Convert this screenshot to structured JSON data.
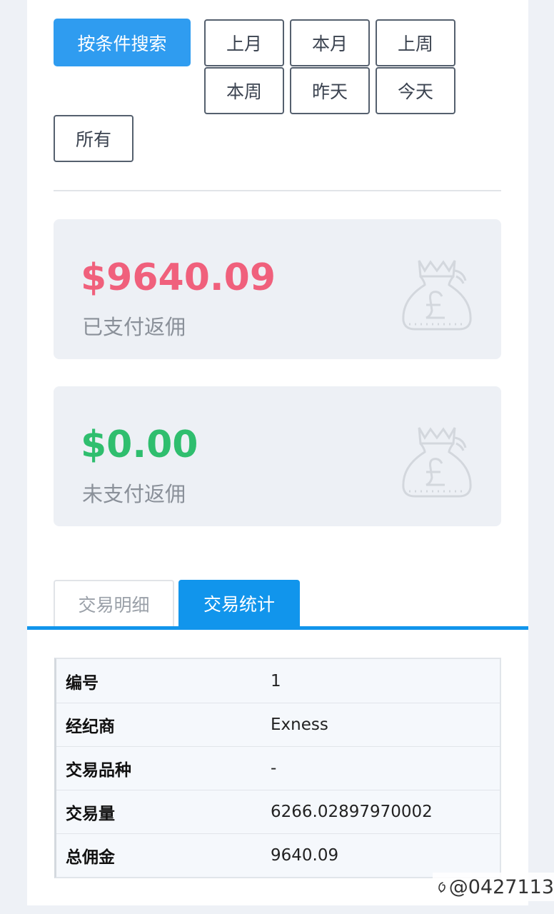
{
  "filters": {
    "search_label": "按条件搜索",
    "last_month": "上月",
    "this_month": "本月",
    "last_week": "上周",
    "this_week": "本周",
    "yesterday": "昨天",
    "today": "今天",
    "all": "所有"
  },
  "cards": {
    "paid": {
      "amount": "$9640.09",
      "label": "已支付返佣",
      "color": "#f0607c"
    },
    "unpaid": {
      "amount": "$0.00",
      "label": "未支付返佣",
      "color": "#2fbe6e"
    }
  },
  "tabs": {
    "details": "交易明细",
    "stats": "交易统计"
  },
  "stats_table": [
    {
      "key": "编号",
      "value": "1"
    },
    {
      "key": "经纪商",
      "value": "Exness"
    },
    {
      "key": "交易品种",
      "value": "-"
    },
    {
      "key": "交易量",
      "value": "6266.02897970002"
    },
    {
      "key": "总佣金",
      "value": "9640.09"
    }
  ],
  "watermark": "@0427113",
  "colors": {
    "accent": "#1195ec",
    "primary_button": "#2f9cf0"
  }
}
